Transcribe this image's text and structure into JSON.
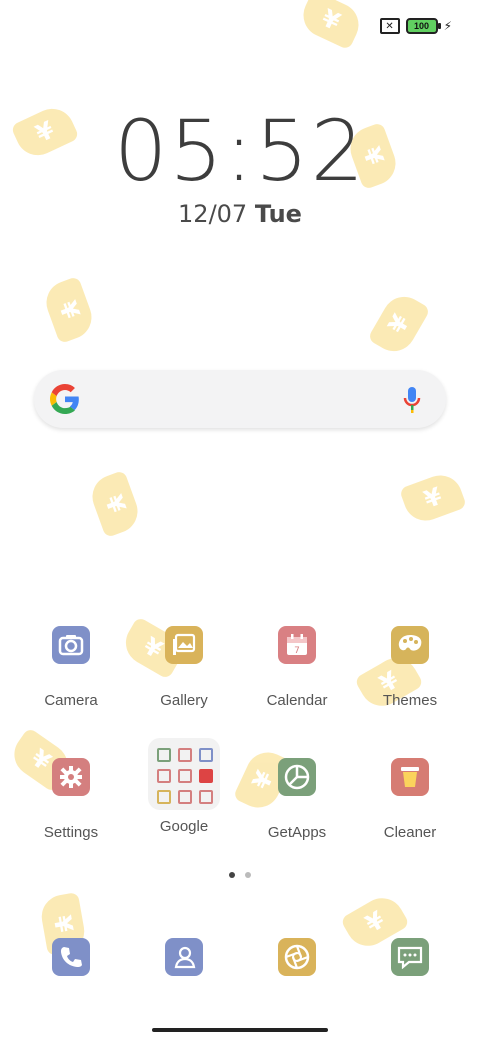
{
  "status_bar": {
    "battery_level": "100",
    "sim": "✕",
    "charging": "⚡"
  },
  "clock": {
    "time": "05:52",
    "date": "12/07",
    "day": "Tue"
  },
  "search_widget": {
    "logo": "G"
  },
  "apps_row1": [
    {
      "label": "Camera",
      "color": "#7f90c8"
    },
    {
      "label": "Gallery",
      "color": "#d9b35a"
    },
    {
      "label": "Calendar",
      "color": "#d98083"
    },
    {
      "label": "Themes",
      "color": "#d6b45b"
    }
  ],
  "apps_row2": [
    {
      "label": "Settings",
      "color": "#d47f7f"
    },
    {
      "label": "Google"
    },
    {
      "label": "GetApps",
      "color": "#7ba07a"
    },
    {
      "label": "Cleaner",
      "color": "#d67c73"
    }
  ],
  "dock": [
    {
      "name": "phone",
      "color": "#7f90c8"
    },
    {
      "name": "contacts",
      "color": "#7f90c8"
    },
    {
      "name": "browser",
      "color": "#d9b35a"
    },
    {
      "name": "messages",
      "color": "#7ba07a"
    }
  ],
  "decor": {
    "coin_glyph": "¥"
  }
}
